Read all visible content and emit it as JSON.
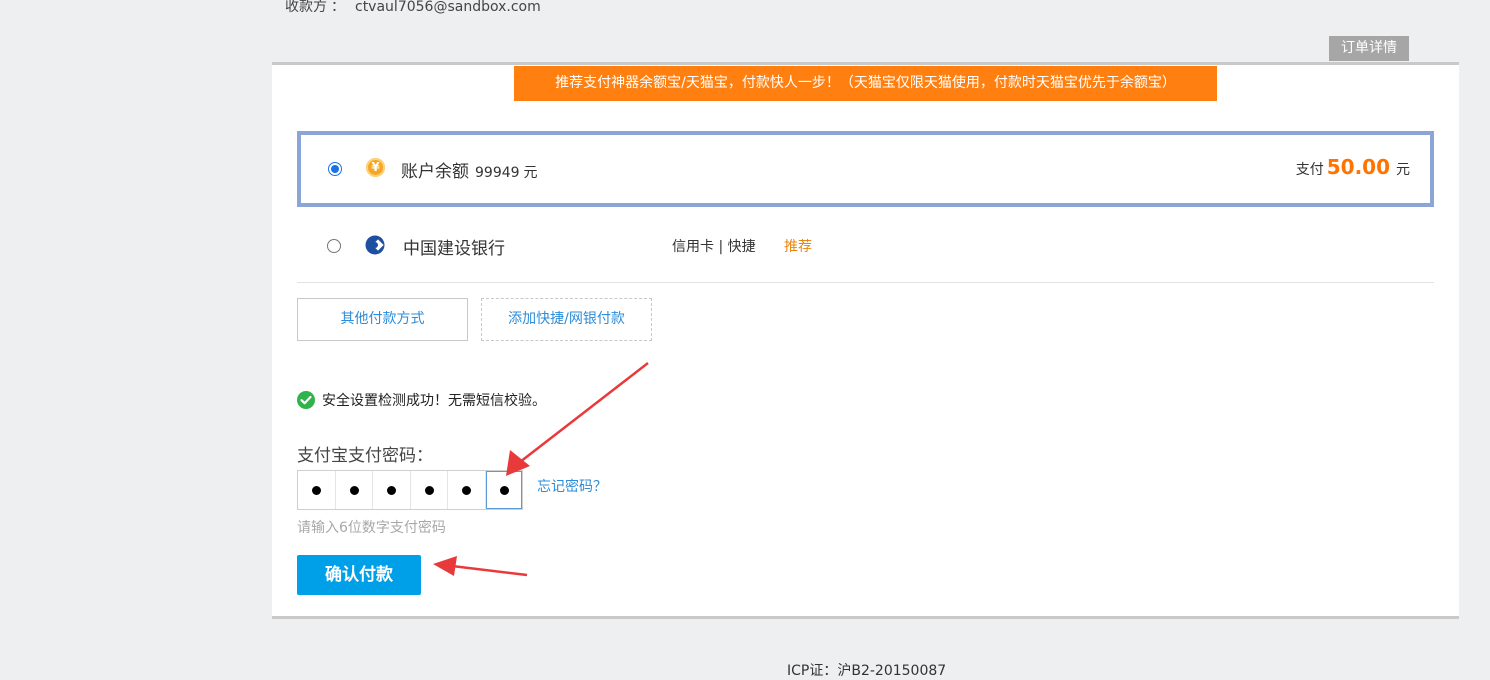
{
  "payee": {
    "label": "收款方",
    "sep": "：",
    "account": "ctvaul7056@sandbox.com"
  },
  "order_detail_label": "订单详情",
  "promo_text": "推荐支付神器余额宝/天猫宝，付款快人一步！（天猫宝仅限天猫使用，付款时天猫宝优先于余额宝）",
  "balance_option": {
    "icon": "yuan-coin-icon",
    "label": "账户余额",
    "amount": "99949",
    "unit": "元",
    "pay_label": "支付",
    "pay_amount": "50.00",
    "pay_unit": "元",
    "selected": true
  },
  "bank_option": {
    "icon": "ccb-bank-icon",
    "label": "中国建设银行",
    "card_type": "信用卡 | 快捷",
    "badge": "推荐",
    "selected": false
  },
  "buttons": {
    "other_methods": "其他付款方式",
    "add_quick": "添加快捷/网银付款",
    "confirm": "确认付款"
  },
  "security_message": "安全设置检测成功！无需短信校验。",
  "password": {
    "label": "支付宝支付密码：",
    "filled_digits": 6,
    "forgot_link": "忘记密码？",
    "hint": "请输入6位数字支付密码"
  },
  "footer_text": "ICP证：沪B2-20150087",
  "colors": {
    "promo_bg": "#ff8010",
    "pay_amount": "#ff7300",
    "confirm_bg": "#00a0e9",
    "link": "#2d8cd8",
    "selected_border": "#8ba6d6",
    "annotation_arrow": "#e83a3a"
  }
}
